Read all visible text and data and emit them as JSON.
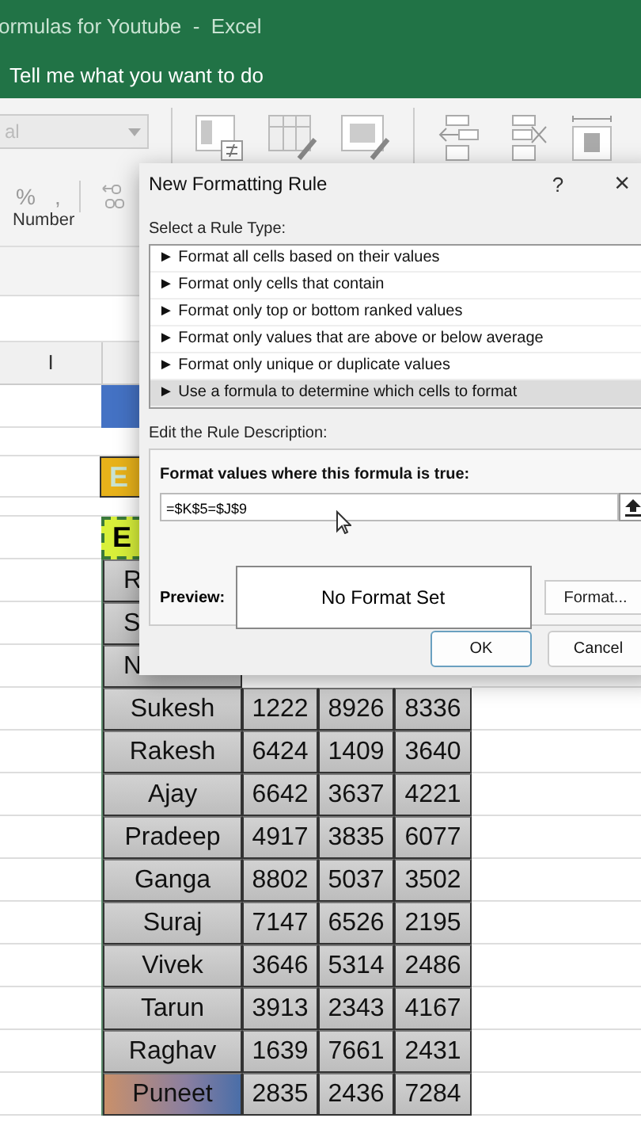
{
  "window": {
    "title": "ormulas for Youtube  -  Excel"
  },
  "tell_me": "Tell me what you want to do",
  "ribbon": {
    "number_format": "al",
    "number_buttons": [
      "%",
      ","
    ],
    "group_label": "Number"
  },
  "sheet": {
    "column_header": "I",
    "rows": [
      {
        "kind": "band",
        "cells": []
      },
      {
        "kind": "blank",
        "cells": []
      },
      {
        "kind": "title",
        "cells": [
          "E"
        ]
      },
      {
        "kind": "blank",
        "cells": []
      },
      {
        "kind": "subtitle",
        "cells": [
          "E"
        ]
      },
      {
        "kind": "data",
        "cells": [
          "R"
        ]
      },
      {
        "kind": "data",
        "cells": [
          "S"
        ]
      },
      {
        "kind": "data",
        "cells": [
          "N"
        ]
      },
      {
        "kind": "data",
        "cells": [
          "Sukesh",
          "1222",
          "8926",
          "8336"
        ]
      },
      {
        "kind": "data",
        "cells": [
          "Rakesh",
          "6424",
          "1409",
          "3640"
        ]
      },
      {
        "kind": "data",
        "cells": [
          "Ajay",
          "6642",
          "3637",
          "4221"
        ]
      },
      {
        "kind": "data",
        "cells": [
          "Pradeep",
          "4917",
          "3835",
          "6077"
        ]
      },
      {
        "kind": "data",
        "cells": [
          "Ganga",
          "8802",
          "5037",
          "3502"
        ]
      },
      {
        "kind": "data",
        "cells": [
          "Suraj",
          "7147",
          "6526",
          "2195"
        ]
      },
      {
        "kind": "data",
        "cells": [
          "Vivek",
          "3646",
          "5314",
          "2486"
        ]
      },
      {
        "kind": "data",
        "cells": [
          "Tarun",
          "3913",
          "2343",
          "4167"
        ]
      },
      {
        "kind": "data",
        "cells": [
          "Raghav",
          "1639",
          "7661",
          "2431"
        ]
      },
      {
        "kind": "highlight",
        "cells": [
          "Puneet",
          "2835",
          "2436",
          "7284"
        ]
      }
    ]
  },
  "dialog": {
    "title": "New Formatting Rule",
    "help": "?",
    "close": "×",
    "rule_type_label": "Select a Rule Type:",
    "rule_types": [
      {
        "label": "► Format all cells based on their values",
        "selected": false
      },
      {
        "label": "► Format only cells that contain",
        "selected": false
      },
      {
        "label": "► Format only top or bottom ranked values",
        "selected": false
      },
      {
        "label": "► Format only values that are above or below average",
        "selected": false
      },
      {
        "label": "► Format only unique or duplicate values",
        "selected": false
      },
      {
        "label": "► Use a formula to determine which cells to format",
        "selected": true
      }
    ],
    "description_label": "Edit the Rule Description:",
    "formula_label": "Format values where this formula is true:",
    "formula": "=$K$5=$J$9",
    "preview_label": "Preview:",
    "preview_text": "No Format Set",
    "format_button": "Format...",
    "ok": "OK",
    "cancel": "Cancel"
  }
}
